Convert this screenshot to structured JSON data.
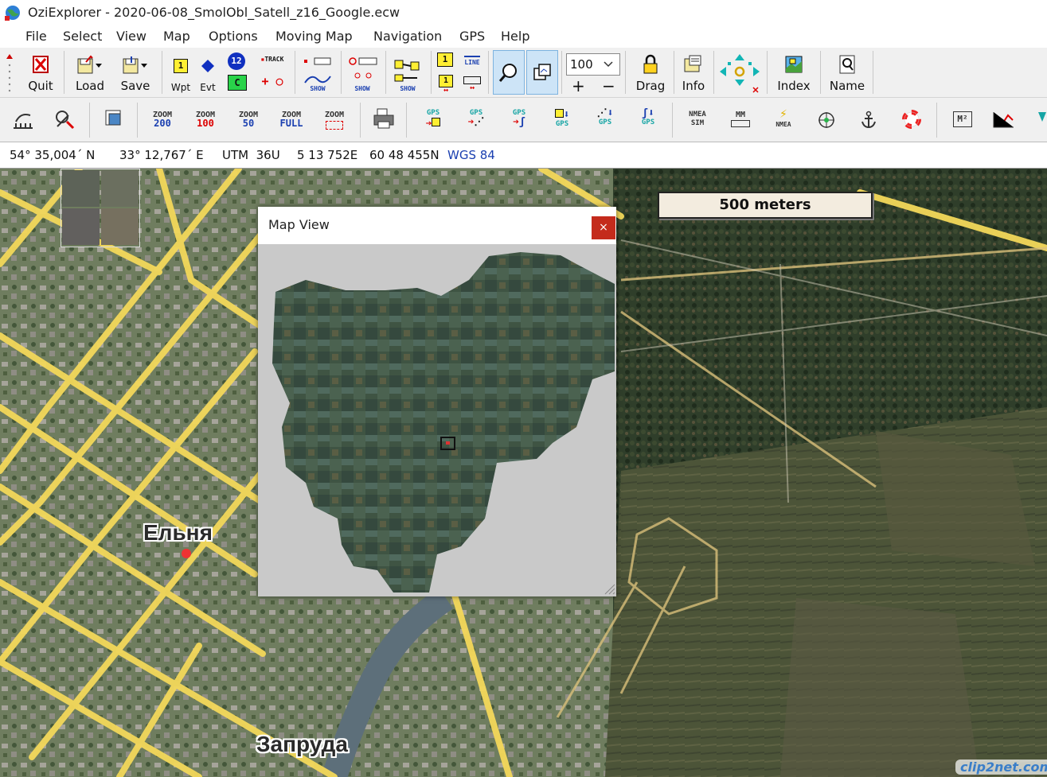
{
  "window": {
    "title": "OziExplorer - 2020-06-08_SmolObl_Satell_z16_Google.ecw"
  },
  "menu": [
    "File",
    "Select",
    "View",
    "Map",
    "Options",
    "Moving Map",
    "Navigation",
    "GPS",
    "Help"
  ],
  "toolbar1": {
    "quit": "Quit",
    "load": "Load",
    "save": "Save",
    "wpt": "Wpt",
    "evt": "Evt",
    "wpt_num": "1",
    "evt_num": "12",
    "c_label": "C",
    "track": "TRACK",
    "show1": "SHOW",
    "show2": "SHOW",
    "show3": "SHOW",
    "line": "LINE",
    "zoom_value": "100",
    "drag": "Drag",
    "info": "Info",
    "index": "Index",
    "name": "Name"
  },
  "toolbar2": {
    "zoom200_top": "ZOOM",
    "zoom200_bottom": "200",
    "zoom100_top": "ZOOM",
    "zoom100_bottom": "100",
    "zoom50_top": "ZOOM",
    "zoom50_bottom": "50",
    "zoomfull_top": "ZOOM",
    "zoomfull_bottom": "FULL",
    "zoomsel_top": "ZOOM",
    "gps1": "GPS",
    "gps2": "GPS",
    "gps3": "GPS",
    "gps4": "GPS",
    "gps5": "GPS",
    "gps6": "GPS",
    "nmea_sim_top": "NMEA",
    "nmea_sim_bottom": "SIM",
    "mm": "MM",
    "nmea": "NMEA",
    "m2": "M²"
  },
  "coords": {
    "lat": "54° 35,004´ N",
    "lon": "33° 12,767´ E",
    "utm": "UTM  36U",
    "easting": "5 13 752E",
    "northing": "60 48 455N",
    "datum": "WGS 84"
  },
  "map": {
    "scale": "500 meters",
    "label_town": "Ельня",
    "label_district": "Запруда"
  },
  "map_view": {
    "title": "Map View",
    "close": "×"
  },
  "watermark": "clip2net.com",
  "colors": {
    "accent_blue": "#1a3fb0",
    "close_red": "#c42b1c",
    "road_yellow": "#f3d85a"
  }
}
